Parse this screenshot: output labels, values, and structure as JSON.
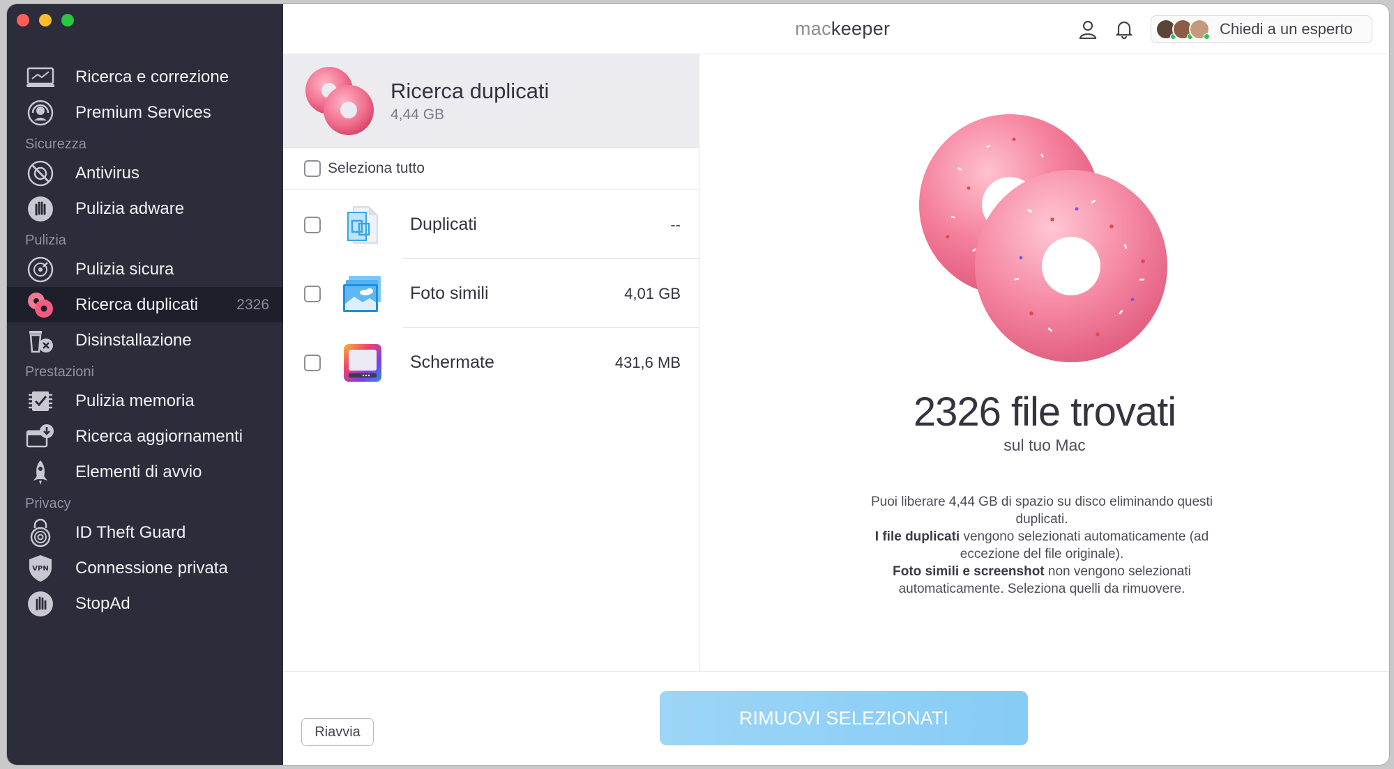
{
  "app": {
    "logo_prefix": "mac",
    "logo_suffix": "keeper"
  },
  "header": {
    "expert_button": "Chiedi a un esperto"
  },
  "sidebar": {
    "items": [
      {
        "label": "Ricerca e correzione",
        "icon": "laptop-scan-icon"
      },
      {
        "label": "Premium Services",
        "icon": "headset-icon"
      },
      {
        "section": "Sicurezza"
      },
      {
        "label": "Antivirus",
        "icon": "antivirus-icon"
      },
      {
        "label": "Pulizia adware",
        "icon": "hand-stop-icon"
      },
      {
        "section": "Pulizia"
      },
      {
        "label": "Pulizia sicura",
        "icon": "disk-clean-icon"
      },
      {
        "label": "Ricerca duplicati",
        "icon": "donut-icon",
        "count": "2326",
        "active": true
      },
      {
        "label": "Disinstallazione",
        "icon": "uninstall-trash-icon"
      },
      {
        "section": "Prestazioni"
      },
      {
        "label": "Pulizia memoria",
        "icon": "memory-chip-icon"
      },
      {
        "label": "Ricerca aggiornamenti",
        "icon": "update-download-icon"
      },
      {
        "label": "Elementi di avvio",
        "icon": "rocket-icon"
      },
      {
        "section": "Privacy"
      },
      {
        "label": "ID Theft Guard",
        "icon": "fingerprint-lock-icon"
      },
      {
        "label": "Connessione privata",
        "icon": "vpn-shield-icon"
      },
      {
        "label": "StopAd",
        "icon": "stop-hand-icon"
      }
    ]
  },
  "list": {
    "title": "Ricerca duplicati",
    "size": "4,44 GB",
    "select_all": "Seleziona tutto",
    "rows": [
      {
        "label": "Duplicati",
        "value": "--",
        "icon": "duplicate-files-icon"
      },
      {
        "label": "Foto simili",
        "value": "4,01 GB",
        "icon": "similar-photos-icon"
      },
      {
        "label": "Schermate",
        "value": "431,6 MB",
        "icon": "screenshots-icon"
      }
    ]
  },
  "detail": {
    "count_text": "2326 file trovati",
    "sub": "sul tuo Mac",
    "desc_line1": "Puoi liberare 4,44 GB di spazio su disco eliminando questi duplicati.",
    "desc_bold2": "I file duplicati",
    "desc_line2": " vengono selezionati automaticamente (ad eccezione del file originale).",
    "desc_bold3": "Foto simili e screenshot",
    "desc_line3": " non vengono selezionati automaticamente. Seleziona quelli da rimuovere."
  },
  "footer": {
    "restart": "Riavvia",
    "remove": "RIMUOVI SELEZIONATI"
  },
  "colors": {
    "sidebar_bg": "#2d2c3b",
    "sidebar_active": "#1f1e2b",
    "accent_button": "#86ccf5",
    "donut_pink": "#f2718f"
  }
}
